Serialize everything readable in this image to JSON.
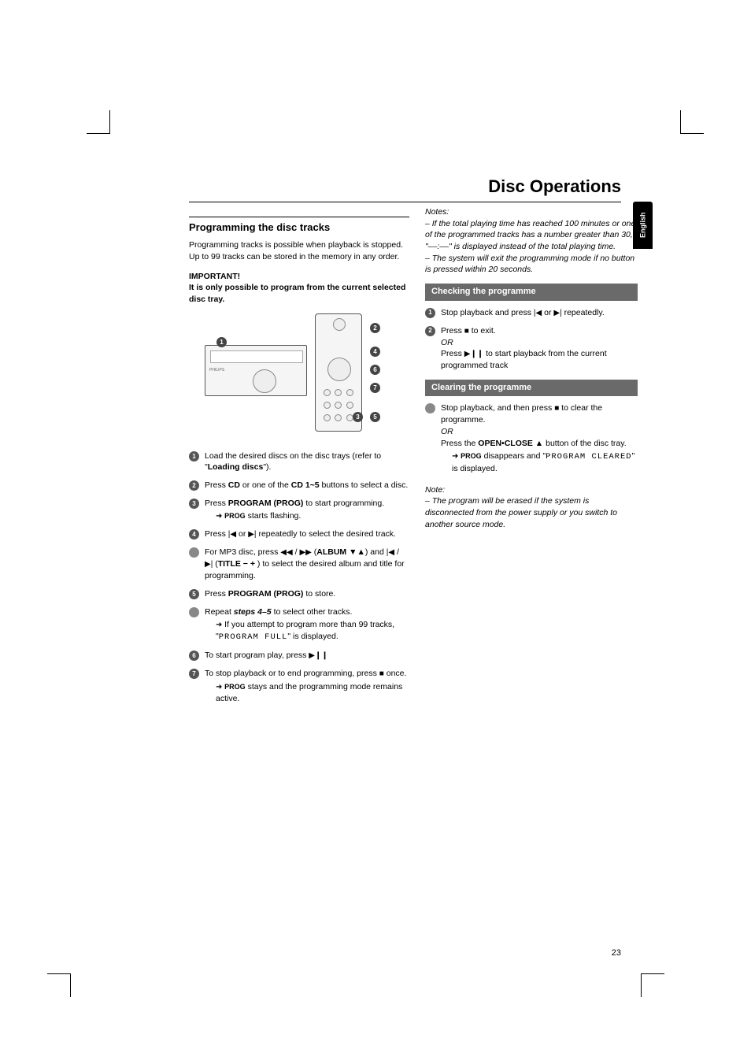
{
  "page_title": "Disc Operations",
  "lang_tab": "English",
  "left": {
    "heading": "Programming the disc tracks",
    "intro": "Programming tracks is possible when playback is stopped. Up to 99 tracks can be stored in the memory in any order.",
    "important_label": "IMPORTANT!",
    "important_text": "It is only possible to program from the current selected disc tray.",
    "steps": [
      {
        "n": "1",
        "kind": "num",
        "body": "Load the desired discs on the disc trays (refer to \"",
        "bold_inline": "Loading discs",
        "body_after": "\")."
      },
      {
        "n": "2",
        "kind": "num",
        "body": "Press ",
        "bold_inline": "CD",
        "body_mid": " or one of the ",
        "bold_inline2": "CD 1~5",
        "body_after": " buttons to select a disc."
      },
      {
        "n": "3",
        "kind": "num",
        "body": "Press ",
        "bold_inline": "PROGRAM (PROG)",
        "body_after": " to start programming.",
        "sub_arrow_sc": "PROG",
        "sub_arrow_after": " starts flashing."
      },
      {
        "n": "4",
        "kind": "num",
        "body": "Press ",
        "icon1": "|◀",
        "mid": " or ",
        "icon2": "▶|",
        "body_after": " repeatedly to select the desired track."
      },
      {
        "n": "",
        "kind": "bullet",
        "body": "For MP3 disc, press ",
        "icon1": "◀◀",
        "mid": " / ",
        "icon2": "▶▶",
        "paren_open": " (",
        "bold_inline": "ALBUM ▼▲",
        "paren_mid": ") and ",
        "icon3": "|◀",
        "mid2": " / ",
        "icon4": "▶|",
        "paren_open2": " (",
        "bold_inline2": "TITLE − +",
        "paren_close": " ) to select the desired album and title for programming."
      },
      {
        "n": "5",
        "kind": "num",
        "body": "Press ",
        "bold_inline": "PROGRAM (PROG)",
        "body_after": " to store."
      },
      {
        "n": "",
        "kind": "bullet",
        "body": "Repeat ",
        "bold_italic": "steps 4–5",
        "body_after": " to select other tracks.",
        "sub_arrow_plain": "If you attempt to program more than 99 tracks, \"",
        "sub_display": "PROGRAM FULL",
        "sub_after": "\" is displayed."
      },
      {
        "n": "6",
        "kind": "num",
        "body": "To start program play, press  ",
        "icon1": "▶❙❙"
      },
      {
        "n": "7",
        "kind": "num",
        "body": "To stop playback or to end programming, press ",
        "icon1": "■",
        "body_after": " once.",
        "sub_arrow_sc": "PROG",
        "sub_arrow_after": " stays and the programming mode remains active."
      }
    ]
  },
  "right": {
    "notes_label": "Notes:",
    "note1": "–  If the total playing time has reached 100 minutes or one of the programmed tracks has a number greater than 30, \"––:––\" is displayed instead of the total playing time.",
    "note2": "–  The system will exit the programming mode if no button is pressed within 20 seconds.",
    "checking_heading": "Checking the programme",
    "check1_pre": "Stop playback and press ",
    "check1_icon1": "|◀",
    "check1_mid": " or ",
    "check1_icon2": "▶|",
    "check1_post": " repeatedly.",
    "check2_pre": "Press ",
    "check2_icon": "■",
    "check2_post": " to exit.",
    "or": "OR",
    "check_or_pre": "Press  ",
    "check_or_icon": "▶❙❙",
    "check_or_post": " to start playback from the current programmed track",
    "clearing_heading": "Clearing the programme",
    "clear_body_pre": "Stop playback, and then press ",
    "clear_body_icon": "■",
    "clear_body_post": " to clear the programme.",
    "clear_or_pre": "Press the ",
    "clear_or_bold": "OPEN•CLOSE ▲",
    "clear_or_post": " button of the disc tray.",
    "clear_arrow_sc": "PROG",
    "clear_arrow_mid": " disappears and \"",
    "clear_display": "PROGRAM CLEARED",
    "clear_arrow_post": "\" is displayed.",
    "note_label": "Note:",
    "note3": "–  The program will be erased if the system is disconnected from the power supply or you switch to another source mode."
  },
  "page_number": "23"
}
